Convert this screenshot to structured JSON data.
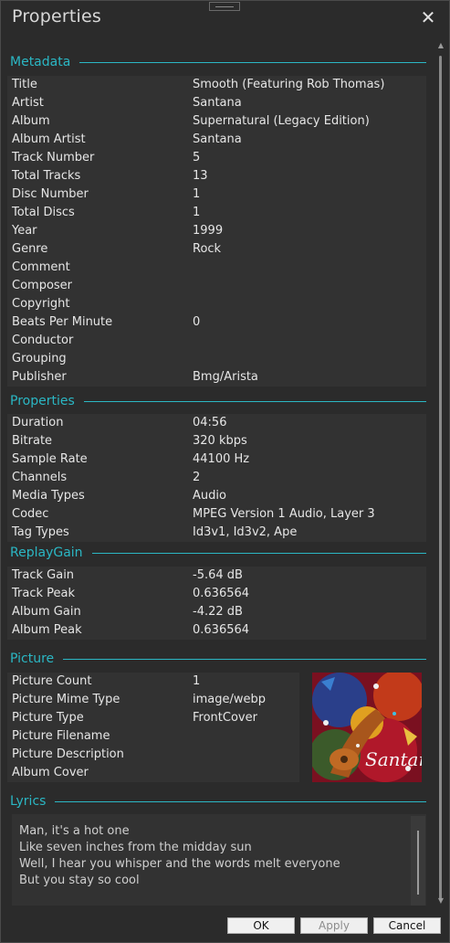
{
  "window": {
    "title": "Properties"
  },
  "sections": {
    "metadata": "Metadata",
    "properties": "Properties",
    "replaygain": "ReplayGain",
    "picture": "Picture",
    "lyrics": "Lyrics"
  },
  "metadata": [
    {
      "label": "Title",
      "value": "Smooth (Featuring Rob Thomas)"
    },
    {
      "label": "Artist",
      "value": "Santana"
    },
    {
      "label": "Album",
      "value": "Supernatural (Legacy Edition)"
    },
    {
      "label": "Album Artist",
      "value": "Santana"
    },
    {
      "label": "Track Number",
      "value": "5"
    },
    {
      "label": "Total Tracks",
      "value": "13"
    },
    {
      "label": "Disc Number",
      "value": "1"
    },
    {
      "label": "Total Discs",
      "value": "1"
    },
    {
      "label": "Year",
      "value": "1999"
    },
    {
      "label": "Genre",
      "value": "Rock"
    },
    {
      "label": "Comment",
      "value": ""
    },
    {
      "label": "Composer",
      "value": ""
    },
    {
      "label": "Copyright",
      "value": ""
    },
    {
      "label": "Beats Per Minute",
      "value": "0"
    },
    {
      "label": "Conductor",
      "value": ""
    },
    {
      "label": "Grouping",
      "value": ""
    },
    {
      "label": "Publisher",
      "value": "Bmg/Arista"
    }
  ],
  "properties": [
    {
      "label": "Duration",
      "value": "04:56"
    },
    {
      "label": "Bitrate",
      "value": "320 kbps"
    },
    {
      "label": "Sample Rate",
      "value": "44100 Hz"
    },
    {
      "label": "Channels",
      "value": "2"
    },
    {
      "label": "Media Types",
      "value": "Audio"
    },
    {
      "label": "Codec",
      "value": "MPEG Version 1 Audio, Layer 3"
    },
    {
      "label": "Tag Types",
      "value": "Id3v1, Id3v2, Ape"
    }
  ],
  "replaygain": [
    {
      "label": "Track Gain",
      "value": "-5.64 dB"
    },
    {
      "label": "Track Peak",
      "value": "0.636564"
    },
    {
      "label": "Album Gain",
      "value": "-4.22 dB"
    },
    {
      "label": "Album Peak",
      "value": "0.636564"
    }
  ],
  "picture": [
    {
      "label": "Picture Count",
      "value": "1"
    },
    {
      "label": "Picture Mime Type",
      "value": "image/webp"
    },
    {
      "label": "Picture Type",
      "value": "FrontCover"
    },
    {
      "label": "Picture Filename",
      "value": ""
    },
    {
      "label": "Picture Description",
      "value": ""
    },
    {
      "label": "Album Cover",
      "value": ""
    }
  ],
  "cover": {
    "logo_text": "Santana"
  },
  "lyrics": [
    "Man, it's a hot one",
    "Like seven inches from the midday sun",
    "Well, I hear you whisper and the words melt everyone",
    "But you stay so cool"
  ],
  "buttons": {
    "ok": "OK",
    "apply": "Apply",
    "cancel": "Cancel"
  },
  "colors": {
    "accent": "#2bb7c4",
    "background": "#2b2b2b",
    "panel": "#323232"
  }
}
